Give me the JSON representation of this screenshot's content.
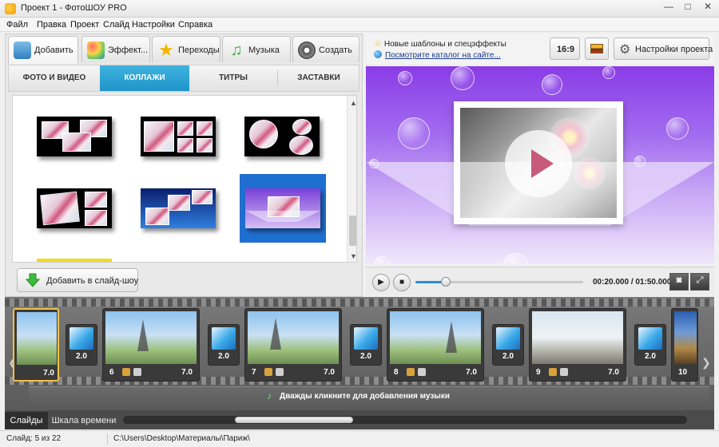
{
  "window": {
    "title": "Проект 1 - ФотоШОУ PRO",
    "min": "—",
    "max": "□",
    "close": "✕"
  },
  "menu": [
    "Файл",
    "Правка",
    "Проект",
    "Слайд",
    "Настройки",
    "Справка"
  ],
  "main_tabs": [
    {
      "label": "Добавить",
      "icon": "camera-icon",
      "active": true
    },
    {
      "label": "Эффект...",
      "icon": "palette-icon"
    },
    {
      "label": "Переходы",
      "icon": "star-icon"
    },
    {
      "label": "Музыка",
      "icon": "music-note-icon"
    },
    {
      "label": "Создать",
      "icon": "film-reel-icon"
    }
  ],
  "sub_tabs": [
    {
      "label": "ФОТО И ВИДЕО"
    },
    {
      "label": "КОЛЛАЖИ",
      "active": true
    },
    {
      "label": "ТИТРЫ"
    },
    {
      "label": "ЗАСТАВКИ"
    }
  ],
  "gallery": {
    "selected_index": 5
  },
  "add_button": {
    "label": "Добавить в слайд-шоу"
  },
  "notice": {
    "line1": "Новые шаблоны и спецэффекты",
    "line2": "Посмотрите каталог на сайте..."
  },
  "toolbar": {
    "aspect_label": "16:9",
    "project_settings_label": "Настройки проекта"
  },
  "player": {
    "timecode": "00:20.000 / 01:50.000",
    "progress": 0.182
  },
  "timeline": {
    "partial_slide": {
      "duration": "7.0"
    },
    "slides": [
      {
        "number": "6",
        "duration": "7.0"
      },
      {
        "number": "7",
        "duration": "7.0"
      },
      {
        "number": "8",
        "duration": "7.0"
      },
      {
        "number": "9",
        "duration": "7.0"
      },
      {
        "number": "10",
        "duration": ""
      }
    ],
    "transitions": [
      "2.0",
      "2.0",
      "2.0",
      "2.0",
      "2.0"
    ],
    "music_hint": "Дважды кликните для добавления музыки"
  },
  "bottom_tabs": [
    {
      "label": "Слайды",
      "active": true
    },
    {
      "label": "Шкала времени"
    }
  ],
  "status": {
    "slide_info": "Слайд: 5 из 22",
    "path": "C:\\Users\\Desktop\\Материалы\\Париж\\"
  },
  "colors": {
    "accent_tab": "#1f95c9",
    "selected_thumb": "#1f6fd1",
    "preview_bg_top": "#8a3ce6",
    "progress_fill": "#2a8bd6"
  }
}
